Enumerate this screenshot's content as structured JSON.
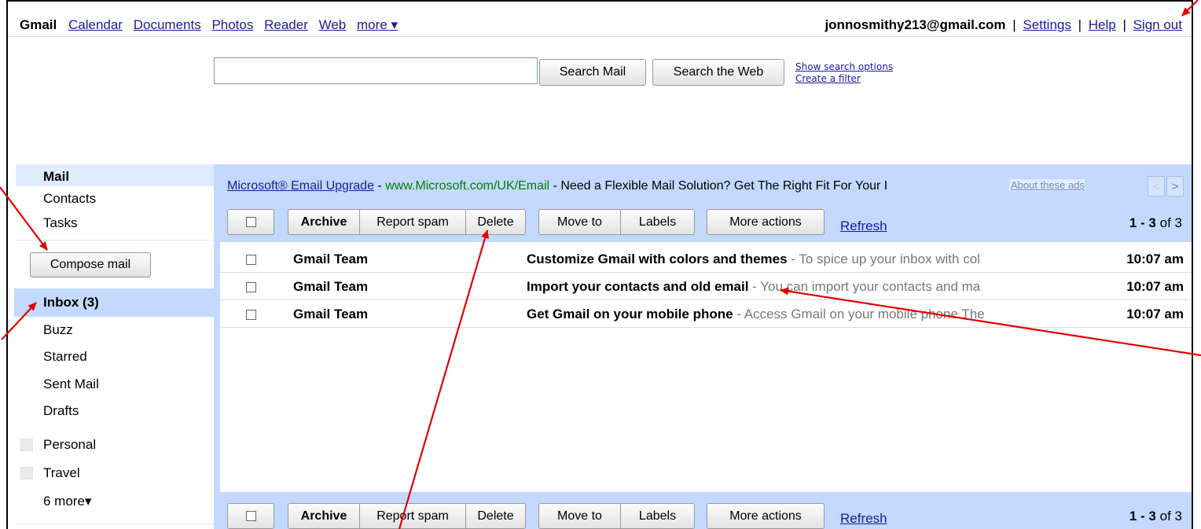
{
  "topbar": {
    "brand": "Gmail",
    "links": [
      "Calendar",
      "Documents",
      "Photos",
      "Reader",
      "Web",
      "more ▾"
    ],
    "email": "jonnosmithy213@gmail.com",
    "settings": "Settings",
    "help": "Help",
    "signout": "Sign out",
    "sep": "|"
  },
  "search": {
    "value": "",
    "search_mail": "Search Mail",
    "search_web": "Search the Web",
    "show_options": "Show search options",
    "create_filter": "Create a filter"
  },
  "leftnav": {
    "mail": "Mail",
    "contacts": "Contacts",
    "tasks": "Tasks",
    "compose": "Compose mail",
    "inbox": "Inbox (3)",
    "buzz": "Buzz",
    "starred": "Starred",
    "sent": "Sent Mail",
    "drafts": "Drafts",
    "labels": [
      "Personal",
      "Travel"
    ],
    "more": "6 more▾"
  },
  "ad": {
    "title": "Microsoft® Email Upgrade",
    "dash1": " - ",
    "url": "www.Microsoft.com/UK/Email",
    "dash2": " - ",
    "text": "Need a Flexible Mail Solution? Get The Right Fit For Your I",
    "about": "About these ads",
    "prev": "<",
    "next": ">"
  },
  "toolbar": {
    "archive": "Archive",
    "report_spam": "Report spam",
    "delete": "Delete",
    "move_to": "Move to",
    "labels": "Labels",
    "more_actions": "More actions",
    "refresh": "Refresh",
    "count_range": "1 - 3",
    "count_of": "of 3"
  },
  "messages": [
    {
      "sender": "Gmail Team",
      "subject": "Customize Gmail with colors and themes",
      "snippet": " - To spice up your inbox with col",
      "time": "10:07 am"
    },
    {
      "sender": "Gmail Team",
      "subject": "Import your contacts and old email",
      "snippet": " - You can import your contacts and ma",
      "time": "10:07 am"
    },
    {
      "sender": "Gmail Team",
      "subject": "Get Gmail on your mobile phone",
      "snippet": " - Access Gmail on your mobile phone The",
      "time": "10:07 am"
    }
  ],
  "colors": {
    "accent_blue": "#c3d9ff",
    "link": "#1a1aa6",
    "annotation_arrow": "#e00000"
  }
}
